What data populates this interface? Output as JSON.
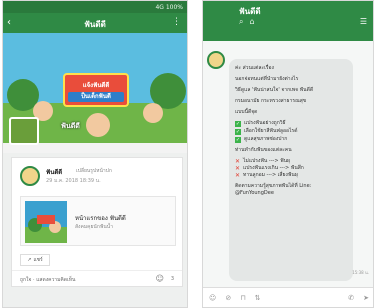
{
  "left": {
    "status": {
      "text": "4G 100%"
    },
    "header": {
      "title": "ฟันดีดี"
    },
    "cover": {
      "line1": "แจ้งฟันดีดี",
      "line2": "ป็นเด็กฟันดี"
    },
    "profile": {
      "name": "ฟันดีดี"
    },
    "post": {
      "author": "ฟันดีดี",
      "subtitle": "เปลี่ยนรูปหน้าปก",
      "date": "29 ม.ค. 2018 18:39 น.",
      "link_title": "หน้าแรกของ ฟันดีดี",
      "link_sub": "สังคมคุยนักฟันน้ำ",
      "share": "แชร์",
      "likes": "ถูกใจ · แสดงความคิดเห็น",
      "comments": "3"
    }
  },
  "right": {
    "header": {
      "title": "ฟันดีดี"
    },
    "chat": {
      "lines": [
        "ค่ะ ส่วนแต่ละเรื่อง",
        "นอกจ่อทนแต่ที่นำมายังต่างไร",
        "วิธีดูแล 'ฟันน่าสนใจ' จากเพจ ฟันดีดี",
        "กรมอนามัย กระทรวงสาธารณสุข",
        "แบบนี้ดีจุด",
        "ท่านทำกับฟันของแต่ละคน"
      ],
      "checks": [
        "แปรงฟันอย่างถูกวิธี",
        "เลือกใช้ยาสีฟันฟลูออไรด์",
        "ดูแลสุขภาพช่องปาก"
      ],
      "crosses": [
        "ไม่แปรงฟัน ---> ฟันผุ",
        "แปรงฟันแรงเกิน ---> ฟันสึก",
        "ทานลูกอม ---> เสี่ยงฟันผุ"
      ],
      "footer": "ติดตามความรู้สุขภาพฟันได้ที่ Line: @FunYoungDee",
      "time": "15:38 น."
    }
  }
}
